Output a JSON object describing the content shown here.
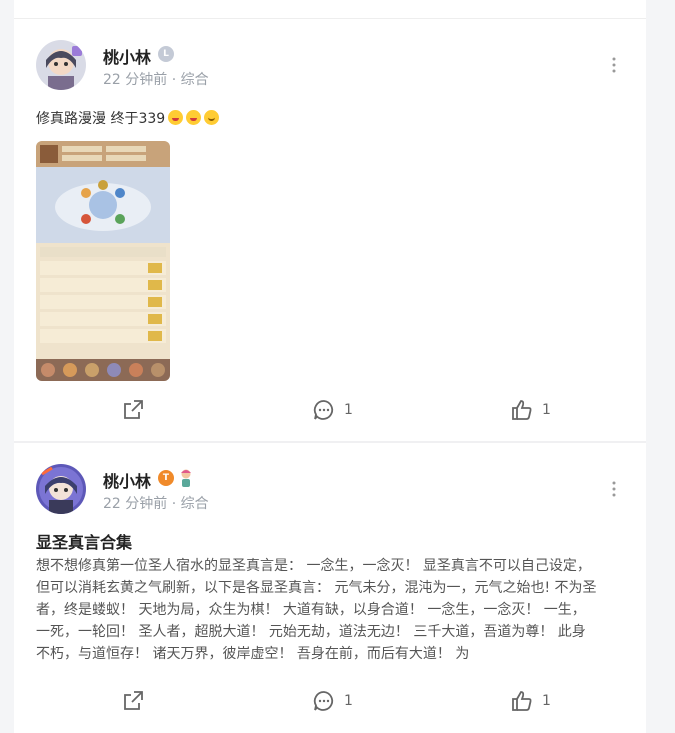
{
  "posts": [
    {
      "author": "桃小林",
      "badge": "L",
      "meta": "22 分钟前 · 综合",
      "text": "修真路漫漫 终于339",
      "emojis": [
        "grin-emoji",
        "grin-emoji",
        "smile-emoji"
      ],
      "share_label": "",
      "comments": "1",
      "likes": "1"
    },
    {
      "author": "桃小林",
      "badge": "T",
      "meta": "22 分钟前 · 综合",
      "title": "显圣真言合集",
      "body_lines": [
        "想不想修真第一位圣人宿水的显圣真言是： 一念生，一念灭！ 显圣真言不可以自己设定，",
        "但可以消耗玄黄之气刷新，以下是各显圣真言： 元气未分，混沌为一，元气之始也! 不为圣",
        "者，终是蝼蚁！ 天地为局，众生为棋！ 大道有缺，以身合道！ 一念生，一念灭！ 一生，",
        "一死，一轮回！ 圣人者，超脱大道！ 元始无劫，道法无边！ 三千大道，吾道为尊！ 此身",
        "不朽，与道恒存！ 诸天万界，彼岸虚空！ 吾身在前，而后有大道！ 为"
      ],
      "comments": "1",
      "likes": "1"
    }
  ],
  "colors": {
    "accent_orange": "#f08a2a",
    "meta_gray": "#9aa0a8"
  }
}
